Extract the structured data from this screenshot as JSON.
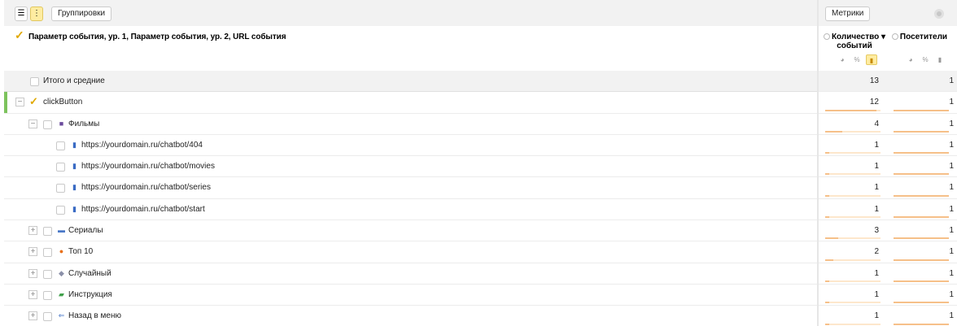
{
  "toolbar": {
    "list_icon": "list-icon",
    "tree_icon": "tree-icon",
    "group_label": "Группировки",
    "metrics_label": "Метрики"
  },
  "header": {
    "dimension_title": "Параметр события, ур. 1, Параметр события, ур. 2, URL события",
    "col_events": "Количество ▾ событий",
    "col_visitors": "Посетители"
  },
  "rows": [
    {
      "label": "Итого и средние",
      "events": "13",
      "visitors": "1",
      "events_frac": 1,
      "visitors_frac": 1
    },
    {
      "label": "clickButton",
      "events": "12",
      "visitors": "1",
      "events_frac": 0.92,
      "visitors_frac": 1
    },
    {
      "label": "Фильмы",
      "events": "4",
      "visitors": "1",
      "events_frac": 0.31,
      "visitors_frac": 1
    },
    {
      "label": "https://yourdomain.ru/chatbot/404",
      "events": "1",
      "visitors": "1",
      "events_frac": 0.08,
      "visitors_frac": 1
    },
    {
      "label": "https://yourdomain.ru/chatbot/movies",
      "events": "1",
      "visitors": "1",
      "events_frac": 0.08,
      "visitors_frac": 1
    },
    {
      "label": "https://yourdomain.ru/chatbot/series",
      "events": "1",
      "visitors": "1",
      "events_frac": 0.08,
      "visitors_frac": 1
    },
    {
      "label": "https://yourdomain.ru/chatbot/start",
      "events": "1",
      "visitors": "1",
      "events_frac": 0.08,
      "visitors_frac": 1
    },
    {
      "label": "Сериалы",
      "events": "3",
      "visitors": "1",
      "events_frac": 0.23,
      "visitors_frac": 1
    },
    {
      "label": "Топ 10",
      "events": "2",
      "visitors": "1",
      "events_frac": 0.15,
      "visitors_frac": 1
    },
    {
      "label": "Случайный",
      "events": "1",
      "visitors": "1",
      "events_frac": 0.08,
      "visitors_frac": 1
    },
    {
      "label": "Инструкция",
      "events": "1",
      "visitors": "1",
      "events_frac": 0.08,
      "visitors_frac": 1
    },
    {
      "label": "Назад в меню",
      "events": "1",
      "visitors": "1",
      "events_frac": 0.08,
      "visitors_frac": 1
    }
  ],
  "colors": {
    "accent": "#ffeca1",
    "bar": "#f6c089",
    "active": "#7dc35d"
  }
}
